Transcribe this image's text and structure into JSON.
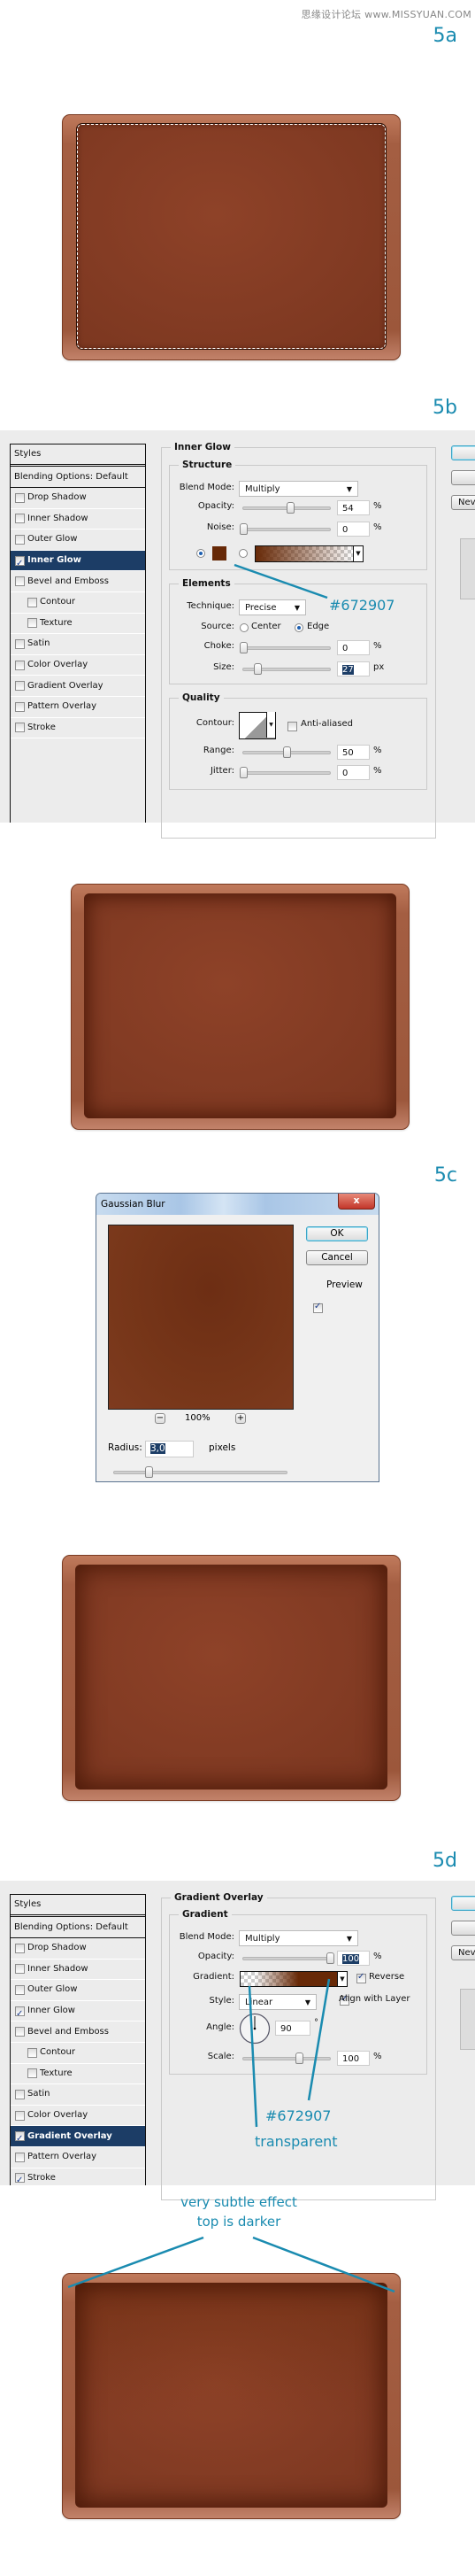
{
  "watermark": "思缘设计论坛 www.MISSYUAN.COM",
  "steps": {
    "a": "5a",
    "b": "5b",
    "c": "5c",
    "d": "5d"
  },
  "colors": {
    "accent": "#1a8bb0",
    "glow_color": "#672907",
    "selected_row": "#1c3d66"
  },
  "styles_panel": {
    "header": "Styles",
    "blending": "Blending Options: Default",
    "items": [
      "Drop Shadow",
      "Inner Shadow",
      "Outer Glow",
      "Inner Glow",
      "Bevel and Emboss",
      "Contour",
      "Texture",
      "Satin",
      "Color Overlay",
      "Gradient Overlay",
      "Pattern Overlay",
      "Stroke"
    ]
  },
  "right_buttons": {
    "new_partial": "Nev"
  },
  "inner_glow": {
    "styles_checked": [
      "Inner Glow"
    ],
    "active": "Inner Glow",
    "title": "Inner Glow",
    "structure": {
      "legend": "Structure",
      "blend_mode_label": "Blend Mode:",
      "blend_mode": "Multiply",
      "opacity_label": "Opacity:",
      "opacity": 54,
      "opacity_unit": "%",
      "noise_label": "Noise:",
      "noise": 0,
      "noise_unit": "%"
    },
    "elements": {
      "legend": "Elements",
      "technique_label": "Technique:",
      "technique": "Precise",
      "source_label": "Source:",
      "source_center": "Center",
      "source_edge": "Edge",
      "source_selected": "Edge",
      "choke_label": "Choke:",
      "choke": 0,
      "choke_unit": "%",
      "size_label": "Size:",
      "size": 27,
      "size_unit": "px"
    },
    "quality": {
      "legend": "Quality",
      "contour_label": "Contour:",
      "anti_aliased": "Anti-aliased",
      "anti_aliased_checked": false,
      "range_label": "Range:",
      "range": 50,
      "range_unit": "%",
      "jitter_label": "Jitter:",
      "jitter": 0,
      "jitter_unit": "%"
    },
    "annotation": "#672907"
  },
  "gaussian_blur": {
    "title": "Gaussian Blur",
    "close": "x",
    "ok": "OK",
    "cancel": "Cancel",
    "preview_label": "Preview",
    "preview_checked": true,
    "zoom_out": "−",
    "zoom_level": "100%",
    "zoom_in": "+",
    "radius_label": "Radius:",
    "radius": "3,0",
    "radius_unit": "pixels",
    "radius_slider_fraction": 0.2
  },
  "gradient_overlay": {
    "styles_checked": [
      "Inner Glow",
      "Gradient Overlay",
      "Stroke"
    ],
    "active": "Gradient Overlay",
    "title": "Gradient Overlay",
    "gradient": {
      "legend": "Gradient",
      "blend_mode_label": "Blend Mode:",
      "blend_mode": "Multiply",
      "opacity_label": "Opacity:",
      "opacity": 100,
      "opacity_unit": "%",
      "gradient_label": "Gradient:",
      "reverse": "Reverse",
      "reverse_checked": true,
      "style_label": "Style:",
      "style": "Linear",
      "align": "Align with Layer",
      "align_checked": true,
      "angle_label": "Angle:",
      "angle": 90,
      "angle_unit": "°",
      "scale_label": "Scale:",
      "scale": 100,
      "scale_unit": "%"
    },
    "annotation_color": "#672907",
    "annotation_transparent": "transparent"
  },
  "final_note": {
    "line1": "very subtle effect",
    "line2": "top is darker"
  }
}
